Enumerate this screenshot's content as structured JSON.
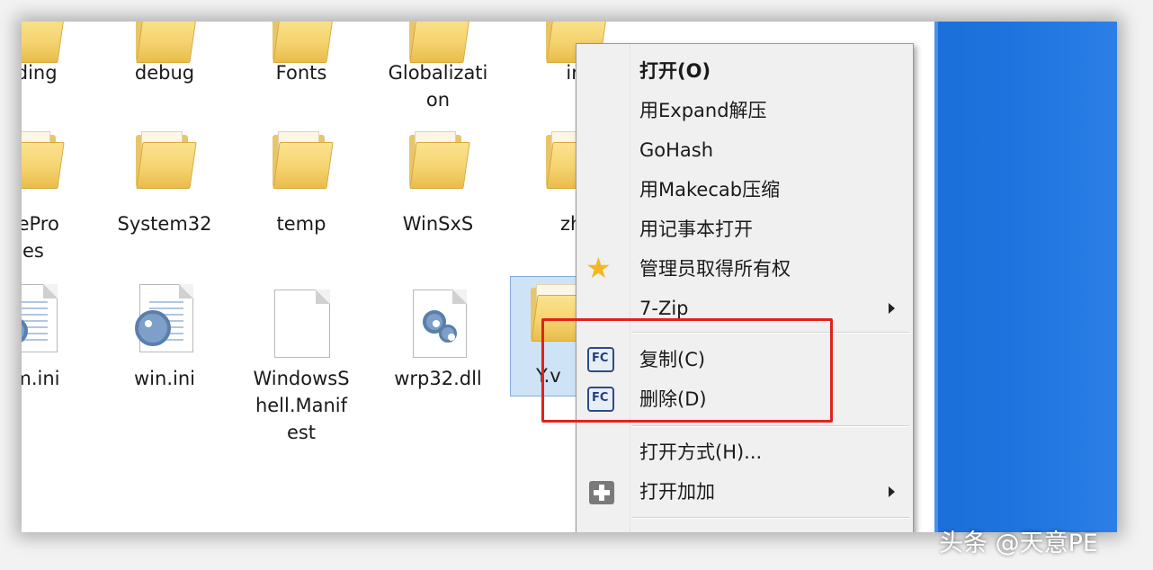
{
  "explorer": {
    "row1": [
      "nding",
      "debug",
      "Fonts",
      "Globalizati\non",
      "in"
    ],
    "row2": [
      "icePro\nles",
      "System32",
      "temp",
      "WinSxS",
      "zh-"
    ],
    "row3": [
      "em.ini",
      "win.ini",
      "WindowsS\nhell.Manif\nest",
      "wrp32.dll"
    ],
    "selected_label": "Y.v"
  },
  "context_menu": {
    "items": [
      {
        "label": "打开(O)"
      },
      {
        "label": "用Expand解压"
      },
      {
        "label": "GoHash"
      },
      {
        "label": "用Makecab压缩"
      },
      {
        "label": "用记事本打开"
      },
      {
        "label": "管理员取得所有权",
        "icon": "star-icon"
      },
      {
        "label": "7-Zip"
      },
      {
        "label": "复制(C)",
        "icon": "fc-icon"
      },
      {
        "label": "删除(D)",
        "icon": "fc-icon"
      },
      {
        "label": "打开方式(H)..."
      },
      {
        "label": "打开加加",
        "icon": "plus-icon"
      }
    ],
    "fc_icon_text": "FC"
  },
  "watermark": "头条 @天意PE",
  "colors": {
    "highlight_border": "#e0231d",
    "desktop_blue": "#1e73de",
    "selection": "#cfe3f7"
  }
}
